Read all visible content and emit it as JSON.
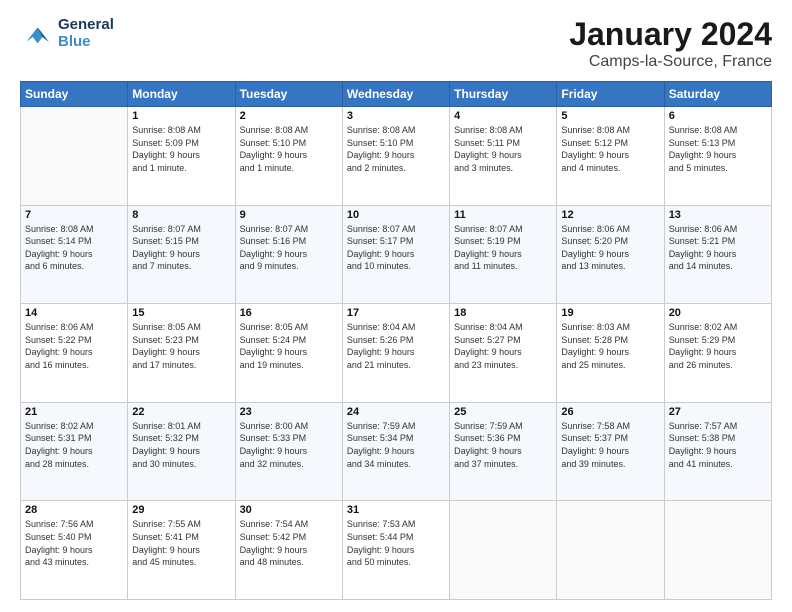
{
  "header": {
    "logo_line1": "General",
    "logo_line2": "Blue",
    "main_title": "January 2024",
    "subtitle": "Camps-la-Source, France"
  },
  "days_of_week": [
    "Sunday",
    "Monday",
    "Tuesday",
    "Wednesday",
    "Thursday",
    "Friday",
    "Saturday"
  ],
  "weeks": [
    [
      {
        "num": "",
        "info": ""
      },
      {
        "num": "1",
        "info": "Sunrise: 8:08 AM\nSunset: 5:09 PM\nDaylight: 9 hours\nand 1 minute."
      },
      {
        "num": "2",
        "info": "Sunrise: 8:08 AM\nSunset: 5:10 PM\nDaylight: 9 hours\nand 1 minute."
      },
      {
        "num": "3",
        "info": "Sunrise: 8:08 AM\nSunset: 5:10 PM\nDaylight: 9 hours\nand 2 minutes."
      },
      {
        "num": "4",
        "info": "Sunrise: 8:08 AM\nSunset: 5:11 PM\nDaylight: 9 hours\nand 3 minutes."
      },
      {
        "num": "5",
        "info": "Sunrise: 8:08 AM\nSunset: 5:12 PM\nDaylight: 9 hours\nand 4 minutes."
      },
      {
        "num": "6",
        "info": "Sunrise: 8:08 AM\nSunset: 5:13 PM\nDaylight: 9 hours\nand 5 minutes."
      }
    ],
    [
      {
        "num": "7",
        "info": "Sunrise: 8:08 AM\nSunset: 5:14 PM\nDaylight: 9 hours\nand 6 minutes."
      },
      {
        "num": "8",
        "info": "Sunrise: 8:07 AM\nSunset: 5:15 PM\nDaylight: 9 hours\nand 7 minutes."
      },
      {
        "num": "9",
        "info": "Sunrise: 8:07 AM\nSunset: 5:16 PM\nDaylight: 9 hours\nand 9 minutes."
      },
      {
        "num": "10",
        "info": "Sunrise: 8:07 AM\nSunset: 5:17 PM\nDaylight: 9 hours\nand 10 minutes."
      },
      {
        "num": "11",
        "info": "Sunrise: 8:07 AM\nSunset: 5:19 PM\nDaylight: 9 hours\nand 11 minutes."
      },
      {
        "num": "12",
        "info": "Sunrise: 8:06 AM\nSunset: 5:20 PM\nDaylight: 9 hours\nand 13 minutes."
      },
      {
        "num": "13",
        "info": "Sunrise: 8:06 AM\nSunset: 5:21 PM\nDaylight: 9 hours\nand 14 minutes."
      }
    ],
    [
      {
        "num": "14",
        "info": "Sunrise: 8:06 AM\nSunset: 5:22 PM\nDaylight: 9 hours\nand 16 minutes."
      },
      {
        "num": "15",
        "info": "Sunrise: 8:05 AM\nSunset: 5:23 PM\nDaylight: 9 hours\nand 17 minutes."
      },
      {
        "num": "16",
        "info": "Sunrise: 8:05 AM\nSunset: 5:24 PM\nDaylight: 9 hours\nand 19 minutes."
      },
      {
        "num": "17",
        "info": "Sunrise: 8:04 AM\nSunset: 5:26 PM\nDaylight: 9 hours\nand 21 minutes."
      },
      {
        "num": "18",
        "info": "Sunrise: 8:04 AM\nSunset: 5:27 PM\nDaylight: 9 hours\nand 23 minutes."
      },
      {
        "num": "19",
        "info": "Sunrise: 8:03 AM\nSunset: 5:28 PM\nDaylight: 9 hours\nand 25 minutes."
      },
      {
        "num": "20",
        "info": "Sunrise: 8:02 AM\nSunset: 5:29 PM\nDaylight: 9 hours\nand 26 minutes."
      }
    ],
    [
      {
        "num": "21",
        "info": "Sunrise: 8:02 AM\nSunset: 5:31 PM\nDaylight: 9 hours\nand 28 minutes."
      },
      {
        "num": "22",
        "info": "Sunrise: 8:01 AM\nSunset: 5:32 PM\nDaylight: 9 hours\nand 30 minutes."
      },
      {
        "num": "23",
        "info": "Sunrise: 8:00 AM\nSunset: 5:33 PM\nDaylight: 9 hours\nand 32 minutes."
      },
      {
        "num": "24",
        "info": "Sunrise: 7:59 AM\nSunset: 5:34 PM\nDaylight: 9 hours\nand 34 minutes."
      },
      {
        "num": "25",
        "info": "Sunrise: 7:59 AM\nSunset: 5:36 PM\nDaylight: 9 hours\nand 37 minutes."
      },
      {
        "num": "26",
        "info": "Sunrise: 7:58 AM\nSunset: 5:37 PM\nDaylight: 9 hours\nand 39 minutes."
      },
      {
        "num": "27",
        "info": "Sunrise: 7:57 AM\nSunset: 5:38 PM\nDaylight: 9 hours\nand 41 minutes."
      }
    ],
    [
      {
        "num": "28",
        "info": "Sunrise: 7:56 AM\nSunset: 5:40 PM\nDaylight: 9 hours\nand 43 minutes."
      },
      {
        "num": "29",
        "info": "Sunrise: 7:55 AM\nSunset: 5:41 PM\nDaylight: 9 hours\nand 45 minutes."
      },
      {
        "num": "30",
        "info": "Sunrise: 7:54 AM\nSunset: 5:42 PM\nDaylight: 9 hours\nand 48 minutes."
      },
      {
        "num": "31",
        "info": "Sunrise: 7:53 AM\nSunset: 5:44 PM\nDaylight: 9 hours\nand 50 minutes."
      },
      {
        "num": "",
        "info": ""
      },
      {
        "num": "",
        "info": ""
      },
      {
        "num": "",
        "info": ""
      }
    ]
  ]
}
